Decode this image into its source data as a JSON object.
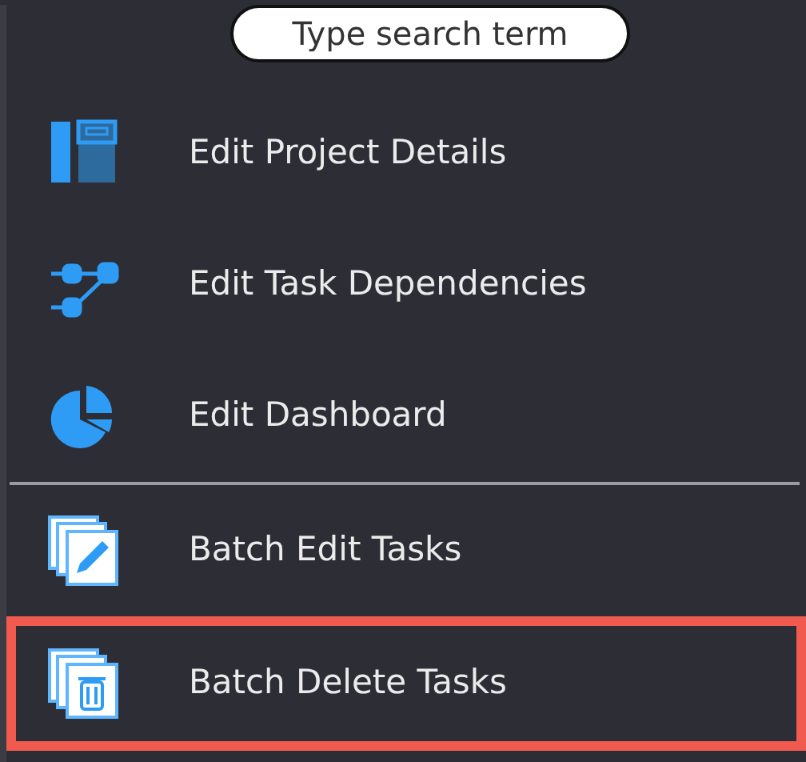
{
  "search": {
    "placeholder": "Type search term"
  },
  "sections": [
    {
      "items": [
        {
          "kind": "details",
          "label": "Edit Project Details",
          "highlighted": false
        },
        {
          "kind": "dependencies",
          "label": "Edit Task Dependencies",
          "highlighted": false
        },
        {
          "kind": "dashboard",
          "label": "Edit Dashboard",
          "highlighted": false
        }
      ]
    },
    {
      "items": [
        {
          "kind": "batch-edit",
          "label": "Batch Edit Tasks",
          "highlighted": false
        },
        {
          "kind": "batch-delete",
          "label": "Batch Delete Tasks",
          "highlighted": true
        }
      ]
    }
  ]
}
